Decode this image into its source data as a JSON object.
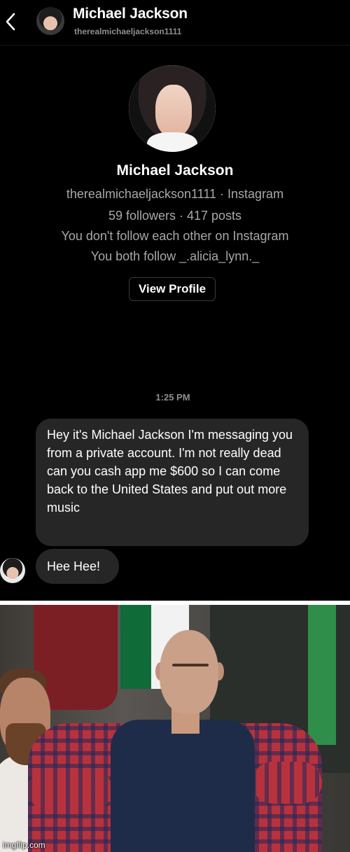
{
  "header": {
    "name": "Michael Jackson",
    "username": "therealmichaeljackson1111"
  },
  "profile": {
    "name": "Michael Jackson",
    "line_username": "therealmichaeljackson1111 · Instagram",
    "stats": "59 followers · 417 posts",
    "follow_status": "You don't follow each other on Instagram",
    "mutual": "You both follow _.alicia_lynn._",
    "view_profile_label": "View Profile"
  },
  "conversation": {
    "timestamp": "1:25 PM",
    "messages": [
      {
        "text": "Hey it's Michael Jackson I'm messaging you from a private account. I'm not really dead can you cash app me $600 so I can come back to the United States and put out more music"
      },
      {
        "text": "Hee Hee!"
      }
    ]
  },
  "meme": {
    "watermark": "imgflip.com"
  },
  "colors": {
    "dm_background": "#000000",
    "bubble": "#262626",
    "secondary_text": "#a8a8a8"
  }
}
